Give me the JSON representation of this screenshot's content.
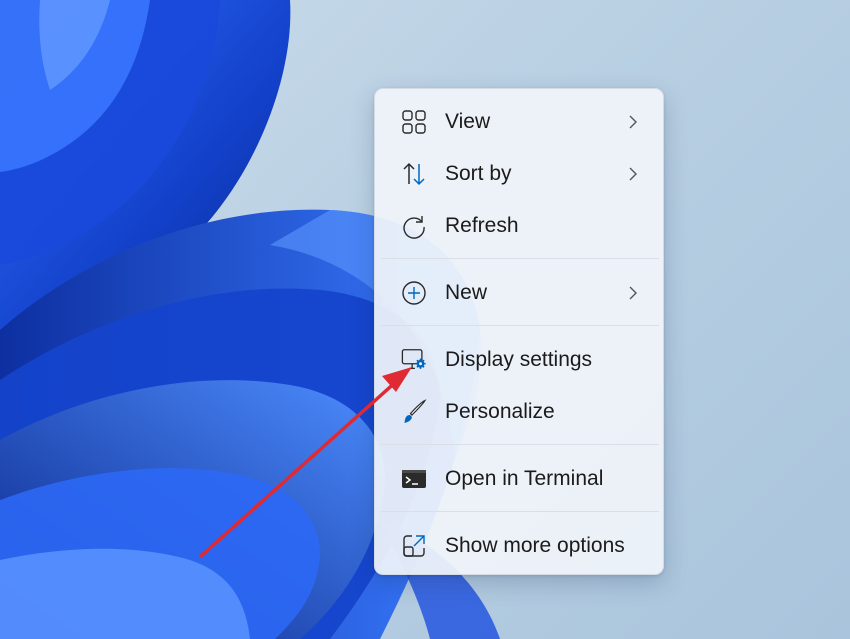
{
  "desktop": {
    "context_menu": {
      "items": [
        {
          "label": "View",
          "icon": "grid-view-icon",
          "submenu": true
        },
        {
          "label": "Sort by",
          "icon": "sort-arrows-icon",
          "submenu": true
        },
        {
          "label": "Refresh",
          "icon": "refresh-icon",
          "submenu": false
        },
        {
          "label": "New",
          "icon": "plus-circle-icon",
          "submenu": true
        },
        {
          "label": "Display settings",
          "icon": "display-settings-icon",
          "submenu": false
        },
        {
          "label": "Personalize",
          "icon": "brush-icon",
          "submenu": false
        },
        {
          "label": "Open in Terminal",
          "icon": "terminal-icon",
          "submenu": false
        },
        {
          "label": "Show more options",
          "icon": "share-box-icon",
          "submenu": false
        }
      ]
    },
    "annotation": {
      "color": "#e02a33"
    },
    "colors": {
      "accent": "#0067c0",
      "wallpaper_blue": "#1f4fd6"
    }
  }
}
